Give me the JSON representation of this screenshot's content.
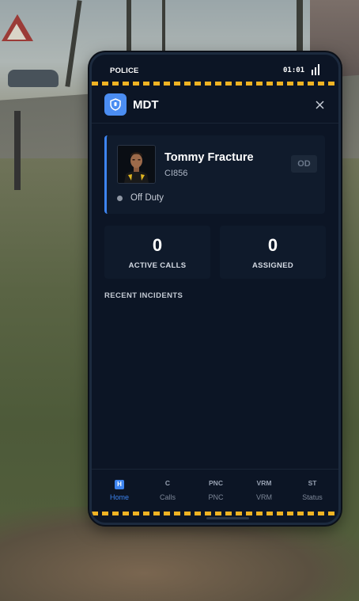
{
  "colors": {
    "accent": "#3d84f0",
    "background": "#0c1525",
    "card": "#101b2c",
    "hazard_stripe": "#f0b323",
    "status_off_duty": "#8e96a3"
  },
  "status_bar": {
    "department": "POLICE",
    "time": "01:01",
    "signal_icon": "signal-icon"
  },
  "header": {
    "title": "MDT",
    "logo_icon": "shield-icon",
    "close_icon": "close-icon"
  },
  "profile": {
    "name": "Tommy Fracture",
    "callsign": "CI856",
    "duty_badge": "OD",
    "status": "Off Duty",
    "avatar_icon": "officer-avatar"
  },
  "stats": [
    {
      "value": "0",
      "label": "ACTIVE CALLS"
    },
    {
      "value": "0",
      "label": "ASSIGNED"
    }
  ],
  "recent_incidents": {
    "title": "RECENT INCIDENTS",
    "items": []
  },
  "nav": [
    {
      "icon": "H",
      "label": "Home",
      "active": true
    },
    {
      "icon": "C",
      "label": "Calls",
      "active": false
    },
    {
      "icon": "PNC",
      "label": "PNC",
      "active": false
    },
    {
      "icon": "VRM",
      "label": "VRM",
      "active": false
    },
    {
      "icon": "ST",
      "label": "Status",
      "active": false
    }
  ]
}
